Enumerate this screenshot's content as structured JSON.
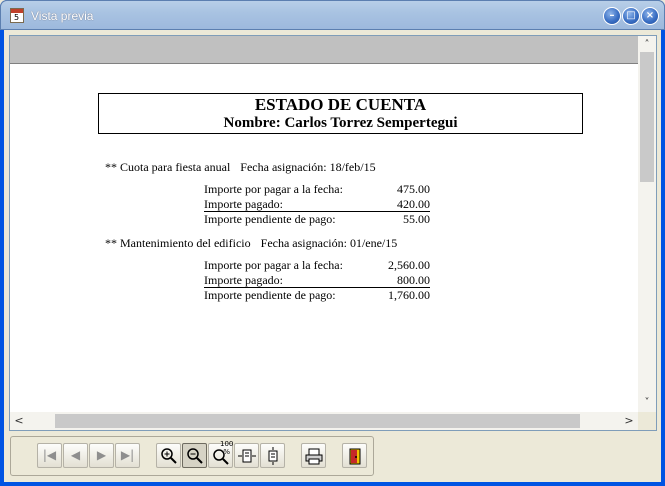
{
  "window": {
    "title": "Vista previa",
    "app_icon_glyph": "5",
    "minimize_glyph": "–",
    "maximize_glyph": "□",
    "close_glyph": "×"
  },
  "report": {
    "title": "ESTADO DE CUENTA",
    "name_line": "Nombre: Carlos Torrez Sempertegui",
    "sections": [
      {
        "concept": "** Cuota para fiesta anual",
        "date_text": "Fecha asignación: 18/feb/15",
        "rows": [
          {
            "label": "Importe por pagar a la fecha:",
            "amount": "475.00"
          },
          {
            "label": "Importe pagado:",
            "amount": "420.00"
          },
          {
            "label": "Importe pendiente de pago:",
            "amount": "55.00"
          }
        ]
      },
      {
        "concept": "** Mantenimiento del edificio",
        "date_text": "Fecha asignación: 01/ene/15",
        "rows": [
          {
            "label": "Importe por pagar a la fecha:",
            "amount": "2,560.00"
          },
          {
            "label": "Importe pagado:",
            "amount": "800.00"
          },
          {
            "label": "Importe pendiente de pago:",
            "amount": "1,760.00"
          }
        ]
      }
    ]
  },
  "scroll": {
    "up_glyph": "˄",
    "down_glyph": "˅",
    "left_glyph": "<",
    "right_glyph": ">"
  },
  "toolbar": {
    "first_glyph": "|◀",
    "prev_glyph": "◀",
    "next_glyph": "▶",
    "last_glyph": "▶|",
    "zoom_100_label": "100 %"
  },
  "icons": [
    "app-icon",
    "minimize-icon",
    "maximize-icon",
    "close-icon",
    "first-page-icon",
    "prev-page-icon",
    "next-page-icon",
    "last-page-icon",
    "zoom-in-icon",
    "zoom-out-icon",
    "zoom-100-icon",
    "page-width-icon",
    "whole-page-icon",
    "print-icon",
    "exit-icon"
  ],
  "colors": {
    "titlebar": "#a9c3e2",
    "window_bg": "#ece9d8",
    "page_band": "#c0c0c0"
  }
}
